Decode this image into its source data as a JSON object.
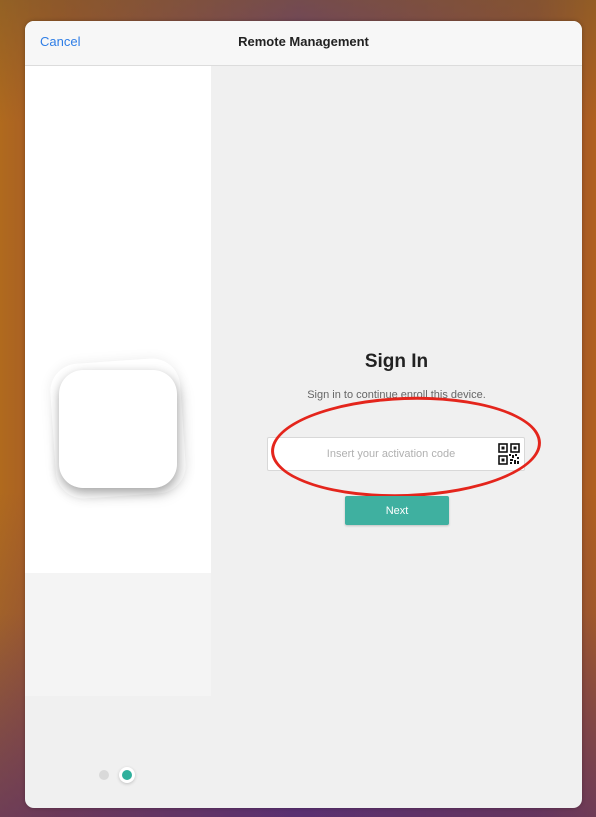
{
  "navbar": {
    "cancel_label": "Cancel",
    "title": "Remote Management"
  },
  "signin": {
    "title": "Sign In",
    "subtitle": "Sign in to continue enroll this device.",
    "code_placeholder": "Insert your activation code",
    "code_value": "",
    "next_label": "Next"
  },
  "icons": {
    "qr": "qr-code-icon",
    "logo": "app-logo-icon"
  },
  "pagination": {
    "total": 2,
    "current": 2
  },
  "colors": {
    "accent": "#3fb0a0",
    "link": "#2f7ee6",
    "annotation": "#e4251c"
  }
}
